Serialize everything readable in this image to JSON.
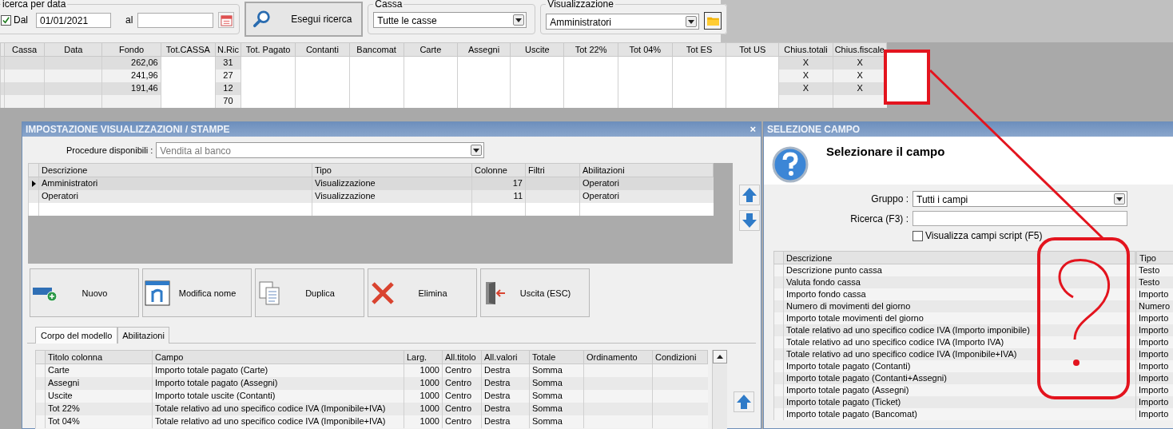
{
  "search_bar": {
    "date_group": {
      "legend": "icerca per data",
      "from_checkbox": {
        "label": "Dal",
        "checked": true
      },
      "from_date": "01/01/2021",
      "to_label": "al"
    },
    "search_button": "Esegui ricerca",
    "cassa_group": {
      "legend": "Cassa",
      "value": "Tutte le casse"
    },
    "view_group": {
      "legend": "Visualizzazione",
      "value": "Amministratori"
    }
  },
  "results_table": {
    "columns": [
      "Cassa",
      "Data",
      "Fondo",
      "Tot.CASSA",
      "N.Ric",
      "Tot. Pagato",
      "Contanti",
      "Bancomat",
      "Carte",
      "Assegni",
      "Uscite",
      "Tot 22%",
      "Tot 04%",
      "Tot ES",
      "Tot US",
      "Chius.totali",
      "Chius.fiscale"
    ],
    "rows": [
      {
        "fondo": "262,06",
        "n_ric": "31",
        "chius_totali": "X",
        "chius_fiscale": "X"
      },
      {
        "fondo": "241,96",
        "n_ric": "27",
        "chius_totali": "X",
        "chius_fiscale": "X"
      },
      {
        "fondo": "191,46",
        "n_ric": "12",
        "chius_totali": "X",
        "chius_fiscale": "X"
      },
      {
        "n_ric": "70"
      }
    ]
  },
  "settings_dialog": {
    "title": "IMPOSTAZIONE VISUALIZZAZIONI / STAMPE",
    "close": "×",
    "procedure_label": "Procedure disponibili :",
    "procedure_value": "Vendita al banco",
    "models_table": {
      "columns": [
        "Descrizione",
        "Tipo",
        "Colonne",
        "Filtri",
        "Abilitazioni"
      ],
      "rows": [
        {
          "selected": true,
          "descrizione": "Amministratori",
          "tipo": "Visualizzazione",
          "colonne": "17",
          "abilitazioni": "Operatori"
        },
        {
          "selected": false,
          "descrizione": "Operatori",
          "tipo": "Visualizzazione",
          "colonne": "11",
          "abilitazioni": "Operatori"
        }
      ]
    },
    "buttons": [
      {
        "label": "Nuovo",
        "kind": "new"
      },
      {
        "label": "Modifica nome",
        "kind": "rename"
      },
      {
        "label": "Duplica",
        "kind": "duplicate"
      },
      {
        "label": "Elimina",
        "kind": "delete"
      },
      {
        "label": "Uscita (ESC)",
        "kind": "exit"
      }
    ],
    "tabs": [
      {
        "label": "Corpo del modello",
        "selected": true
      },
      {
        "label": "Abilitazioni",
        "selected": false
      }
    ],
    "columns_table": {
      "columns": [
        "Titolo colonna",
        "Campo",
        "Larg.",
        "All.titolo",
        "All.valori",
        "Totale",
        "Ordinamento",
        "Condizioni"
      ],
      "rows": [
        {
          "titolo": "Carte",
          "campo": "Importo totale pagato (Carte)",
          "larg": "1000",
          "all_titolo": "Centro",
          "all_valori": "Destra",
          "totale": "Somma"
        },
        {
          "titolo": "Assegni",
          "campo": "Importo totale pagato (Assegni)",
          "larg": "1000",
          "all_titolo": "Centro",
          "all_valori": "Destra",
          "totale": "Somma"
        },
        {
          "titolo": "Uscite",
          "campo": "Importo totale uscite (Contanti)",
          "larg": "1000",
          "all_titolo": "Centro",
          "all_valori": "Destra",
          "totale": "Somma"
        },
        {
          "titolo": "Tot 22%",
          "campo": "Totale relativo ad uno specifico codice IVA (Imponibile+IVA)",
          "larg": "1000",
          "all_titolo": "Centro",
          "all_valori": "Destra",
          "totale": "Somma"
        },
        {
          "titolo": "Tot 04%",
          "campo": "Totale relativo ad uno specifico codice IVA (Imponibile+IVA)",
          "larg": "1000",
          "all_titolo": "Centro",
          "all_valori": "Destra",
          "totale": "Somma"
        }
      ]
    }
  },
  "field_dialog": {
    "title": "SELEZIONE CAMPO",
    "heading": "Selezionare il campo",
    "group_label": "Gruppo :",
    "group_value": "Tutti i campi",
    "search_label": "Ricerca (F3) :",
    "script_checkbox": {
      "label": "Visualizza campi script (F5)",
      "checked": false
    },
    "fields_table": {
      "columns": [
        "Descrizione",
        "Tipo"
      ],
      "rows": [
        {
          "descrizione": "Descrizione punto cassa",
          "tipo": "Testo"
        },
        {
          "descrizione": "Valuta fondo cassa",
          "tipo": "Testo"
        },
        {
          "descrizione": "Importo fondo cassa",
          "tipo": "Importo"
        },
        {
          "descrizione": "Numero di movimenti del giorno",
          "tipo": "Numero"
        },
        {
          "descrizione": "Importo totale movimenti del giorno",
          "tipo": "Importo"
        },
        {
          "descrizione": "Totale relativo ad uno specifico codice IVA (Importo imponibile)",
          "tipo": "Importo"
        },
        {
          "descrizione": "Totale relativo ad uno specifico codice IVA (Importo IVA)",
          "tipo": "Importo"
        },
        {
          "descrizione": "Totale relativo ad uno specifico codice IVA (Imponibile+IVA)",
          "tipo": "Importo"
        },
        {
          "descrizione": "Importo totale pagato (Contanti)",
          "tipo": "Importo"
        },
        {
          "descrizione": "Importo totale pagato (Contanti+Assegni)",
          "tipo": "Importo"
        },
        {
          "descrizione": "Importo totale pagato (Assegni)",
          "tipo": "Importo"
        },
        {
          "descrizione": "Importo totale pagato (Ticket)",
          "tipo": "Importo"
        },
        {
          "descrizione": "Importo totale pagato (Bancomat)",
          "tipo": "Importo"
        }
      ]
    }
  }
}
